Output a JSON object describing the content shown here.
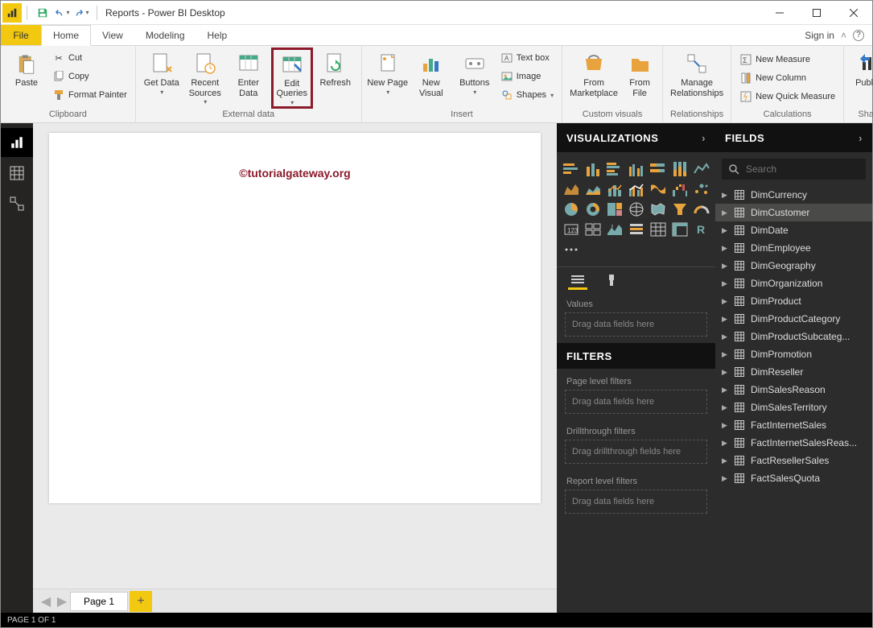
{
  "title": "Reports - Power BI Desktop",
  "menubar": {
    "file": "File",
    "home": "Home",
    "view": "View",
    "modeling": "Modeling",
    "help": "Help",
    "signin": "Sign in"
  },
  "ribbon": {
    "clipboard": {
      "label": "Clipboard",
      "paste": "Paste",
      "cut": "Cut",
      "copy": "Copy",
      "format_painter": "Format Painter"
    },
    "external": {
      "label": "External data",
      "get_data": "Get Data",
      "recent_sources": "Recent Sources",
      "enter_data": "Enter Data",
      "edit_queries": "Edit Queries",
      "refresh": "Refresh"
    },
    "insert": {
      "label": "Insert",
      "new_page": "New Page",
      "new_visual": "New Visual",
      "buttons": "Buttons",
      "text_box": "Text box",
      "image": "Image",
      "shapes": "Shapes"
    },
    "custom": {
      "label": "Custom visuals",
      "marketplace": "From Marketplace",
      "file": "From File"
    },
    "relationships": {
      "label": "Relationships",
      "manage": "Manage Relationships"
    },
    "calculations": {
      "label": "Calculations",
      "new_measure": "New Measure",
      "new_column": "New Column",
      "quick_measure": "New Quick Measure"
    },
    "share": {
      "label": "Share",
      "publish": "Publish"
    }
  },
  "watermark": "©tutorialgateway.org",
  "pages": {
    "page1": "Page 1"
  },
  "status": "PAGE 1 OF 1",
  "vis": {
    "header": "VISUALIZATIONS",
    "values": "Values",
    "drag_data": "Drag data fields here",
    "filters_header": "FILTERS",
    "page_filters": "Page level filters",
    "drill_filters": "Drillthrough filters",
    "drag_drill": "Drag drillthrough fields here",
    "report_filters": "Report level filters"
  },
  "fields": {
    "header": "FIELDS",
    "search_placeholder": "Search",
    "tables": [
      "DimCurrency",
      "DimCustomer",
      "DimDate",
      "DimEmployee",
      "DimGeography",
      "DimOrganization",
      "DimProduct",
      "DimProductCategory",
      "DimProductSubcateg...",
      "DimPromotion",
      "DimReseller",
      "DimSalesReason",
      "DimSalesTerritory",
      "FactInternetSales",
      "FactInternetSalesReas...",
      "FactResellerSales",
      "FactSalesQuota"
    ],
    "selected": "DimCustomer"
  }
}
